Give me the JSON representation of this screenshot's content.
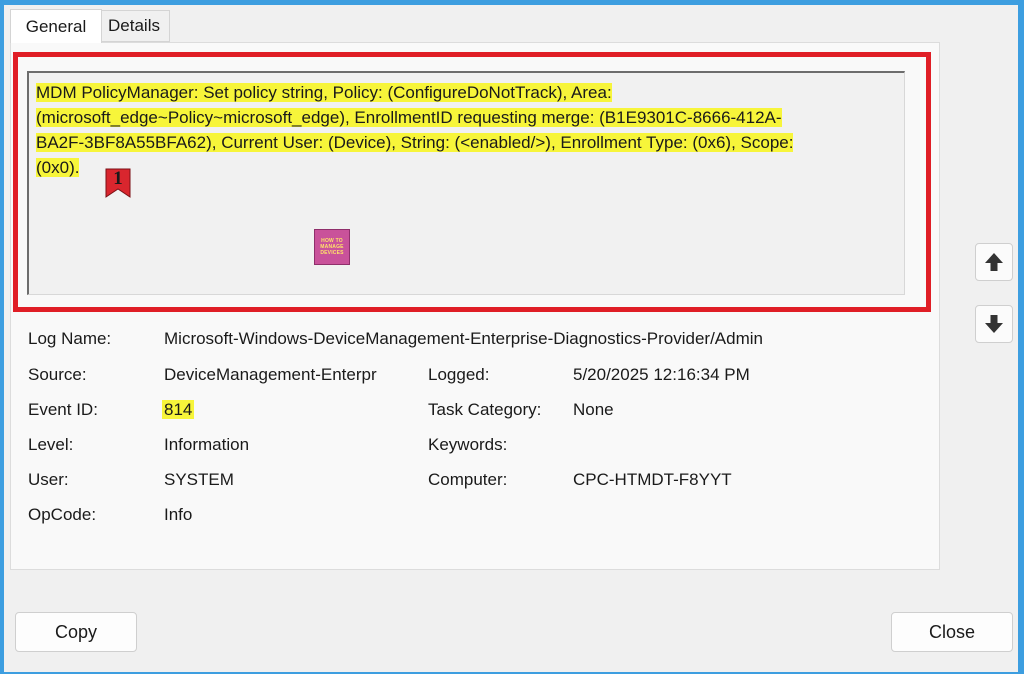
{
  "tabs": {
    "general": "General",
    "details": "Details"
  },
  "message": {
    "lines": [
      "MDM PolicyManager: Set policy string, Policy: (ConfigureDoNotTrack), Area:",
      "(microsoft_edge~Policy~microsoft_edge), EnrollmentID requesting merge: (B1E9301C-8666-412A-",
      "BA2F-3BF8A55BFA62), Current User: (Device), String: (<enabled/>), Enrollment Type: (0x6), Scope:",
      "(0x0)."
    ]
  },
  "annotation": {
    "marker_number": "1"
  },
  "logo": {
    "line1": "HOW TO",
    "line2": "MANAGE",
    "line3": "DEVICES"
  },
  "properties": {
    "log_name_label": "Log Name:",
    "log_name_value": "Microsoft-Windows-DeviceManagement-Enterprise-Diagnostics-Provider/Admin",
    "source_label": "Source:",
    "source_value": "DeviceManagement-Enterpr",
    "logged_label": "Logged:",
    "logged_value": "5/20/2025 12:16:34 PM",
    "event_id_label": "Event ID:",
    "event_id_value": "814",
    "task_category_label": "Task Category:",
    "task_category_value": "None",
    "level_label": "Level:",
    "level_value": "Information",
    "keywords_label": "Keywords:",
    "keywords_value": "",
    "user_label": "User:",
    "user_value": "SYSTEM",
    "computer_label": "Computer:",
    "computer_value": "CPC-HTMDT-F8YYT",
    "opcode_label": "OpCode:",
    "opcode_value": "Info"
  },
  "buttons": {
    "copy": "Copy",
    "close": "Close"
  },
  "icons": {
    "scroll_up": "arrow-up-icon",
    "scroll_down": "arrow-down-icon"
  },
  "colors": {
    "highlight": "#f7f53a",
    "annotation_border": "#e01e26",
    "background_frame": "#3d9ee0"
  }
}
